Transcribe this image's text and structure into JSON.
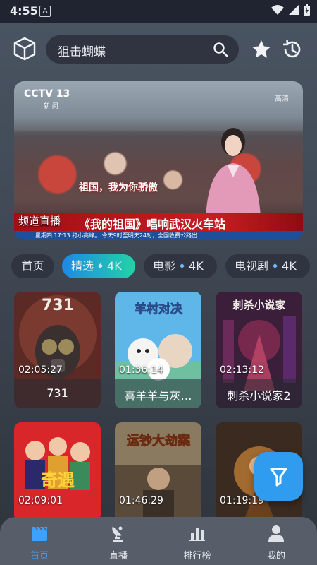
{
  "status_bar": {
    "time": "4:55",
    "notification_glyph": "A"
  },
  "search": {
    "query": "狙击蝴蝶"
  },
  "banner": {
    "channel_logo": "CCTV 13",
    "channel_sub": "新 闻",
    "quality_badge": "高清",
    "slogan": "祖国，我为你骄傲",
    "headline": "《我的祖国》唱响武汉火车站",
    "ticker": "星期四  17:13  打小高峰。  今天9时至明天24时，全国收费公路出",
    "overlay_label": "频道直播"
  },
  "tabs": [
    {
      "label": "首页",
      "badge": ""
    },
    {
      "label": "精选",
      "badge": "4K",
      "active": true
    },
    {
      "label": "电影",
      "badge": "4K"
    },
    {
      "label": "电视剧",
      "badge": "4K"
    }
  ],
  "cards": [
    {
      "title": "731",
      "duration": "02:05:27",
      "poster_text": "731"
    },
    {
      "title": "喜羊羊与灰…",
      "duration": "01:36:14",
      "poster_text": "羊村对决"
    },
    {
      "title": "刺杀小说家2",
      "duration": "02:13:12",
      "poster_text": "刺杀小说家"
    },
    {
      "title": "",
      "duration": "02:09:01",
      "poster_text": "奇遇"
    },
    {
      "title": "",
      "duration": "01:46:29",
      "poster_text": "运钞大劫案"
    },
    {
      "title": "",
      "duration": "01:19:19",
      "poster_text": ""
    }
  ],
  "nav": [
    {
      "label": "首页",
      "icon": "clapperboard-icon",
      "active": true
    },
    {
      "label": "直播",
      "icon": "satellite-dish-icon"
    },
    {
      "label": "排行榜",
      "icon": "bar-chart-icon"
    },
    {
      "label": "我的",
      "icon": "person-icon"
    }
  ],
  "colors": {
    "accent": "#3ea0ff",
    "active_tab_start": "#1e88e5",
    "active_tab_end": "#22d3a6",
    "fab": "#2f9cf0",
    "nav_bg": "#575e69"
  }
}
